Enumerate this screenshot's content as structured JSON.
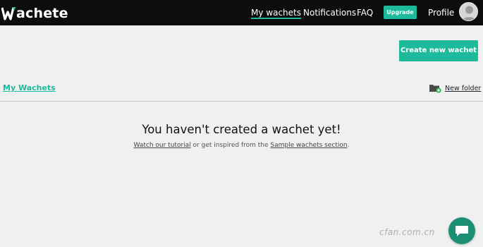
{
  "app": {
    "logo_text": "achete",
    "brand_color": "#1dba9b"
  },
  "nav": {
    "my_wachets": "My wachets",
    "notifications": "Notifications",
    "faq": "FAQ",
    "upgrade": "Upgrade",
    "profile": "Profile"
  },
  "toolbar": {
    "create_label": "Create new wachet"
  },
  "breadcrumb": {
    "label": "My Wachets"
  },
  "folder": {
    "new_folder_label": "New folder",
    "icon": "folder-add-icon"
  },
  "empty_state": {
    "title": "You haven't created a wachet yet!",
    "tutorial_link": "Watch our tutorial",
    "middle_text": " or get inspired from the ",
    "samples_link": "Sample wachets section",
    "end_text": "."
  },
  "chat": {
    "icon": "chat-icon"
  },
  "watermark": {
    "text": "cfan.com.cn"
  }
}
